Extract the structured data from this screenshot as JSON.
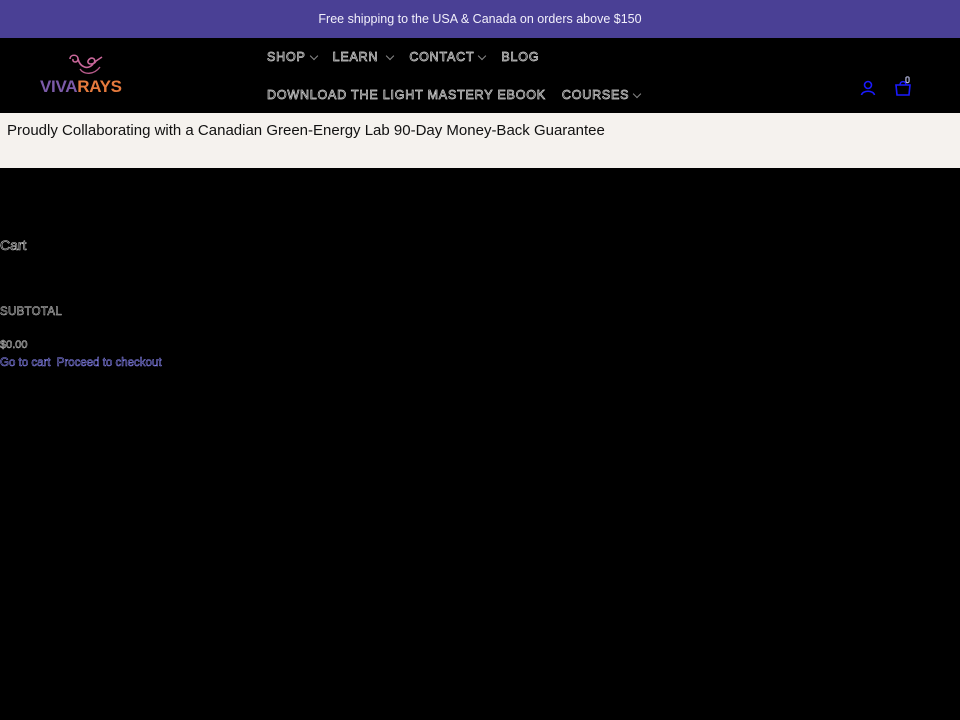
{
  "announcement": {
    "text": "Free shipping to the USA & Canada on orders above $150"
  },
  "brand": {
    "name_part1": "VIVA",
    "name_part2": "RAYS",
    "logo_icon": "spiral-swirl-logo-icon"
  },
  "nav": {
    "row1": [
      {
        "label": "SHOP",
        "has_dropdown": true
      },
      {
        "label": "LEARN",
        "has_dropdown": true
      },
      {
        "label": "CONTACT",
        "has_dropdown": true
      },
      {
        "label": "BLOG",
        "has_dropdown": false
      }
    ],
    "row2": [
      {
        "label": "DOWNLOAD THE LIGHT MASTERY EBOOK",
        "has_dropdown": false
      },
      {
        "label": "COURSES",
        "has_dropdown": true
      }
    ]
  },
  "header_icons": {
    "account_icon": "account-icon",
    "cart_icon": "cart-icon",
    "cart_count": "0"
  },
  "promo": {
    "text": "Proudly Collaborating with a Canadian Green-Energy Lab 90-Day Money-Back Guarantee"
  },
  "cart": {
    "title": "Cart",
    "subtotal_label": "SUBTOTAL",
    "subtotal_value": "$0.00",
    "go_to_cart": "Go to cart",
    "checkout": "Proceed to checkout"
  },
  "colors": {
    "announcement_bg": "#4a4095",
    "promo_bg": "#f5f2ee",
    "link": "#8f8cff",
    "icon_blue": "#1a1aff",
    "logo_purple": "#7b5aa8",
    "logo_orange": "#e57a3d"
  }
}
